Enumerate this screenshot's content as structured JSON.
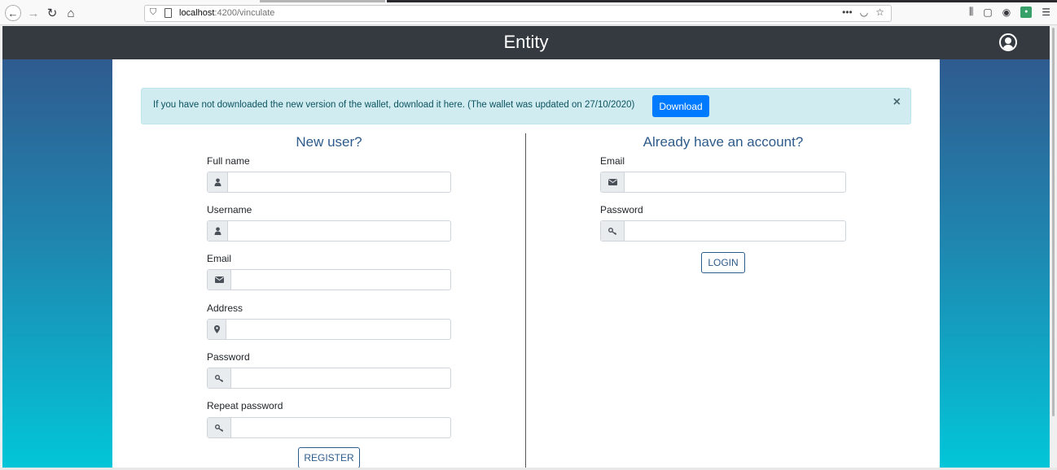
{
  "browser": {
    "url_host": "localhost",
    "url_path": ":4200/vinculate"
  },
  "header": {
    "title": "Entity"
  },
  "alert": {
    "message": "If you have not downloaded the new version of the wallet, download it here. (The wallet was updated on 27/10/2020)",
    "download_label": "Download",
    "close_glyph": "×"
  },
  "register": {
    "title": "New user?",
    "fields": [
      {
        "label": "Full name",
        "icon": "user-icon",
        "value": ""
      },
      {
        "label": "Username",
        "icon": "user-icon",
        "value": ""
      },
      {
        "label": "Email",
        "icon": "envelope-icon",
        "value": ""
      },
      {
        "label": "Address",
        "icon": "map-marker-icon",
        "value": ""
      },
      {
        "label": "Password",
        "icon": "key-icon",
        "value": ""
      },
      {
        "label": "Repeat password",
        "icon": "key-icon",
        "value": ""
      }
    ],
    "button_label": "REGISTER"
  },
  "login": {
    "title": "Already have an account?",
    "fields": [
      {
        "label": "Email",
        "icon": "envelope-icon",
        "value": ""
      },
      {
        "label": "Password",
        "icon": "key-icon",
        "value": ""
      }
    ],
    "button_label": "LOGIN"
  },
  "colors": {
    "header_bg": "#343a40",
    "accent": "#2d5b8c",
    "primary": "#007bff",
    "alert_bg": "#d1ecf1"
  }
}
